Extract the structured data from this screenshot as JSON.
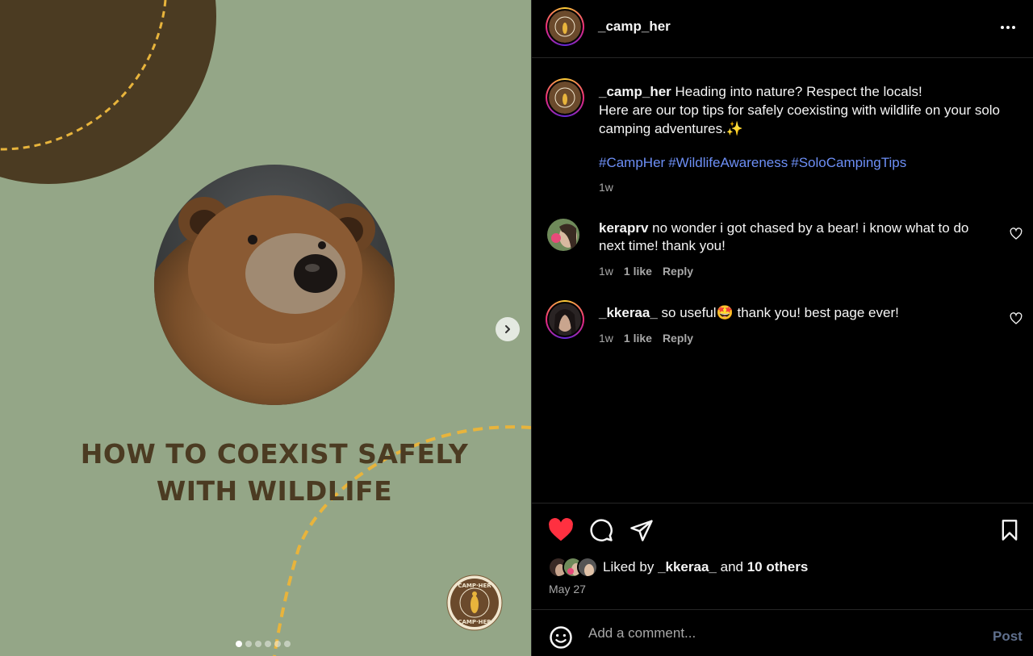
{
  "media": {
    "title": "HOW TO COEXIST SAFELY WITH WILDLIFE",
    "logo_text_top": "CAMP·HER",
    "logo_text_bottom": "CAMP·HER",
    "slide_count": 6,
    "active_slide": 1,
    "bg_color": "#94a687",
    "accent_color": "#4b3b22",
    "dash_color": "#e8b43c"
  },
  "header": {
    "username": "_camp_her"
  },
  "caption": {
    "username": "_camp_her",
    "line1": "Heading into nature? Respect the locals!",
    "line2": "Here are our top tips for safely coexisting with wildlife on your solo camping adventures.",
    "emoji": "✨",
    "hashtags": [
      "#CampHer",
      "#WildlifeAwareness",
      "#SoloCampingTips"
    ],
    "time": "1w"
  },
  "comments": [
    {
      "username": "keraprv",
      "text": "no wonder i got chased by a bear! i know what to do next time! thank you!",
      "time": "1w",
      "likes": "1 like",
      "reply": "Reply"
    },
    {
      "username": "_kkeraa_",
      "text_before": "so useful",
      "emoji": "🤩",
      "text_after": " thank you! best page ever!",
      "time": "1w",
      "likes": "1 like",
      "reply": "Reply"
    }
  ],
  "actions": {
    "liked_by_prefix": "Liked by",
    "liked_by_user": "_kkeraa_",
    "and": "and",
    "others": "10 others",
    "date": "May 27",
    "like_color": "#ff3040"
  },
  "add_comment": {
    "placeholder": "Add a comment...",
    "post_label": "Post"
  }
}
